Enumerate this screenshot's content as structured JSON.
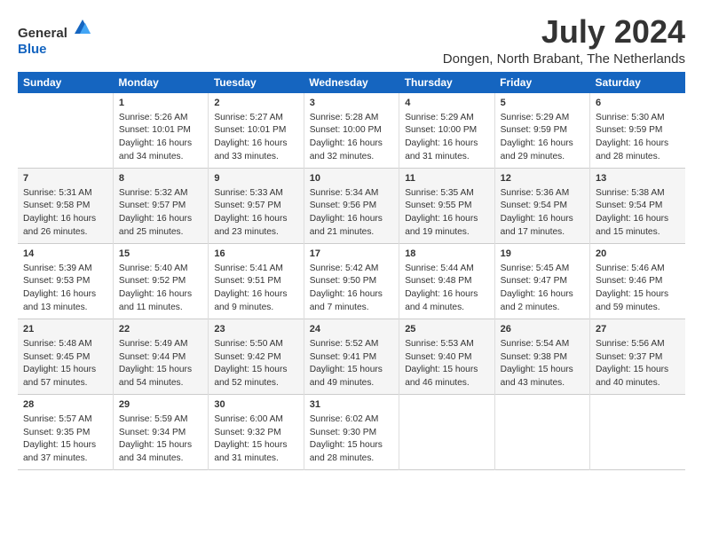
{
  "logo": {
    "general": "General",
    "blue": "Blue"
  },
  "title": "July 2024",
  "location": "Dongen, North Brabant, The Netherlands",
  "days_header": [
    "Sunday",
    "Monday",
    "Tuesday",
    "Wednesday",
    "Thursday",
    "Friday",
    "Saturday"
  ],
  "weeks": [
    [
      {
        "day": "",
        "content": ""
      },
      {
        "day": "1",
        "content": "Sunrise: 5:26 AM\nSunset: 10:01 PM\nDaylight: 16 hours\nand 34 minutes."
      },
      {
        "day": "2",
        "content": "Sunrise: 5:27 AM\nSunset: 10:01 PM\nDaylight: 16 hours\nand 33 minutes."
      },
      {
        "day": "3",
        "content": "Sunrise: 5:28 AM\nSunset: 10:00 PM\nDaylight: 16 hours\nand 32 minutes."
      },
      {
        "day": "4",
        "content": "Sunrise: 5:29 AM\nSunset: 10:00 PM\nDaylight: 16 hours\nand 31 minutes."
      },
      {
        "day": "5",
        "content": "Sunrise: 5:29 AM\nSunset: 9:59 PM\nDaylight: 16 hours\nand 29 minutes."
      },
      {
        "day": "6",
        "content": "Sunrise: 5:30 AM\nSunset: 9:59 PM\nDaylight: 16 hours\nand 28 minutes."
      }
    ],
    [
      {
        "day": "7",
        "content": "Sunrise: 5:31 AM\nSunset: 9:58 PM\nDaylight: 16 hours\nand 26 minutes."
      },
      {
        "day": "8",
        "content": "Sunrise: 5:32 AM\nSunset: 9:57 PM\nDaylight: 16 hours\nand 25 minutes."
      },
      {
        "day": "9",
        "content": "Sunrise: 5:33 AM\nSunset: 9:57 PM\nDaylight: 16 hours\nand 23 minutes."
      },
      {
        "day": "10",
        "content": "Sunrise: 5:34 AM\nSunset: 9:56 PM\nDaylight: 16 hours\nand 21 minutes."
      },
      {
        "day": "11",
        "content": "Sunrise: 5:35 AM\nSunset: 9:55 PM\nDaylight: 16 hours\nand 19 minutes."
      },
      {
        "day": "12",
        "content": "Sunrise: 5:36 AM\nSunset: 9:54 PM\nDaylight: 16 hours\nand 17 minutes."
      },
      {
        "day": "13",
        "content": "Sunrise: 5:38 AM\nSunset: 9:54 PM\nDaylight: 16 hours\nand 15 minutes."
      }
    ],
    [
      {
        "day": "14",
        "content": "Sunrise: 5:39 AM\nSunset: 9:53 PM\nDaylight: 16 hours\nand 13 minutes."
      },
      {
        "day": "15",
        "content": "Sunrise: 5:40 AM\nSunset: 9:52 PM\nDaylight: 16 hours\nand 11 minutes."
      },
      {
        "day": "16",
        "content": "Sunrise: 5:41 AM\nSunset: 9:51 PM\nDaylight: 16 hours\nand 9 minutes."
      },
      {
        "day": "17",
        "content": "Sunrise: 5:42 AM\nSunset: 9:50 PM\nDaylight: 16 hours\nand 7 minutes."
      },
      {
        "day": "18",
        "content": "Sunrise: 5:44 AM\nSunset: 9:48 PM\nDaylight: 16 hours\nand 4 minutes."
      },
      {
        "day": "19",
        "content": "Sunrise: 5:45 AM\nSunset: 9:47 PM\nDaylight: 16 hours\nand 2 minutes."
      },
      {
        "day": "20",
        "content": "Sunrise: 5:46 AM\nSunset: 9:46 PM\nDaylight: 15 hours\nand 59 minutes."
      }
    ],
    [
      {
        "day": "21",
        "content": "Sunrise: 5:48 AM\nSunset: 9:45 PM\nDaylight: 15 hours\nand 57 minutes."
      },
      {
        "day": "22",
        "content": "Sunrise: 5:49 AM\nSunset: 9:44 PM\nDaylight: 15 hours\nand 54 minutes."
      },
      {
        "day": "23",
        "content": "Sunrise: 5:50 AM\nSunset: 9:42 PM\nDaylight: 15 hours\nand 52 minutes."
      },
      {
        "day": "24",
        "content": "Sunrise: 5:52 AM\nSunset: 9:41 PM\nDaylight: 15 hours\nand 49 minutes."
      },
      {
        "day": "25",
        "content": "Sunrise: 5:53 AM\nSunset: 9:40 PM\nDaylight: 15 hours\nand 46 minutes."
      },
      {
        "day": "26",
        "content": "Sunrise: 5:54 AM\nSunset: 9:38 PM\nDaylight: 15 hours\nand 43 minutes."
      },
      {
        "day": "27",
        "content": "Sunrise: 5:56 AM\nSunset: 9:37 PM\nDaylight: 15 hours\nand 40 minutes."
      }
    ],
    [
      {
        "day": "28",
        "content": "Sunrise: 5:57 AM\nSunset: 9:35 PM\nDaylight: 15 hours\nand 37 minutes."
      },
      {
        "day": "29",
        "content": "Sunrise: 5:59 AM\nSunset: 9:34 PM\nDaylight: 15 hours\nand 34 minutes."
      },
      {
        "day": "30",
        "content": "Sunrise: 6:00 AM\nSunset: 9:32 PM\nDaylight: 15 hours\nand 31 minutes."
      },
      {
        "day": "31",
        "content": "Sunrise: 6:02 AM\nSunset: 9:30 PM\nDaylight: 15 hours\nand 28 minutes."
      },
      {
        "day": "",
        "content": ""
      },
      {
        "day": "",
        "content": ""
      },
      {
        "day": "",
        "content": ""
      }
    ]
  ]
}
